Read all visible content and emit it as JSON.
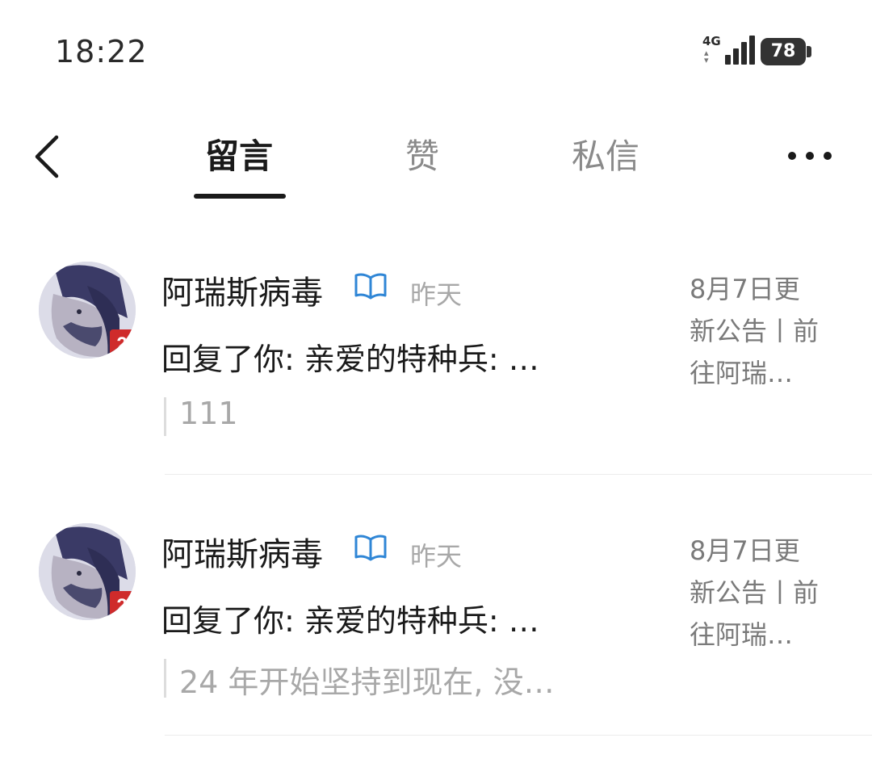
{
  "status_bar": {
    "time": "18:22",
    "network": "4G",
    "battery": "78"
  },
  "nav": {
    "tabs": [
      {
        "label": "留言",
        "active": true
      },
      {
        "label": "赞",
        "active": false
      },
      {
        "label": "私信",
        "active": false
      }
    ],
    "back_icon": "chevron-left-icon",
    "more_icon": "more-horizontal-icon"
  },
  "messages": [
    {
      "username": "阿瑞斯病毒",
      "badge_icon": "book-verified-icon",
      "time": "昨天",
      "reply": "回复了你: 亲爱的特种兵: …",
      "quote": "111",
      "preview_lines": [
        "8月7日更",
        "新公告丨前",
        "往阿瑞…"
      ]
    },
    {
      "username": "阿瑞斯病毒",
      "badge_icon": "book-verified-icon",
      "time": "昨天",
      "reply": "回复了你: 亲爱的特种兵: …",
      "quote": "24 年开始坚持到现在, 没…",
      "preview_lines": [
        "8月7日更",
        "新公告丨前",
        "往阿瑞…"
      ]
    }
  ],
  "colors": {
    "verified": "#2f86d6",
    "muted": "#a8a8a8",
    "text": "#1a1a1a"
  }
}
